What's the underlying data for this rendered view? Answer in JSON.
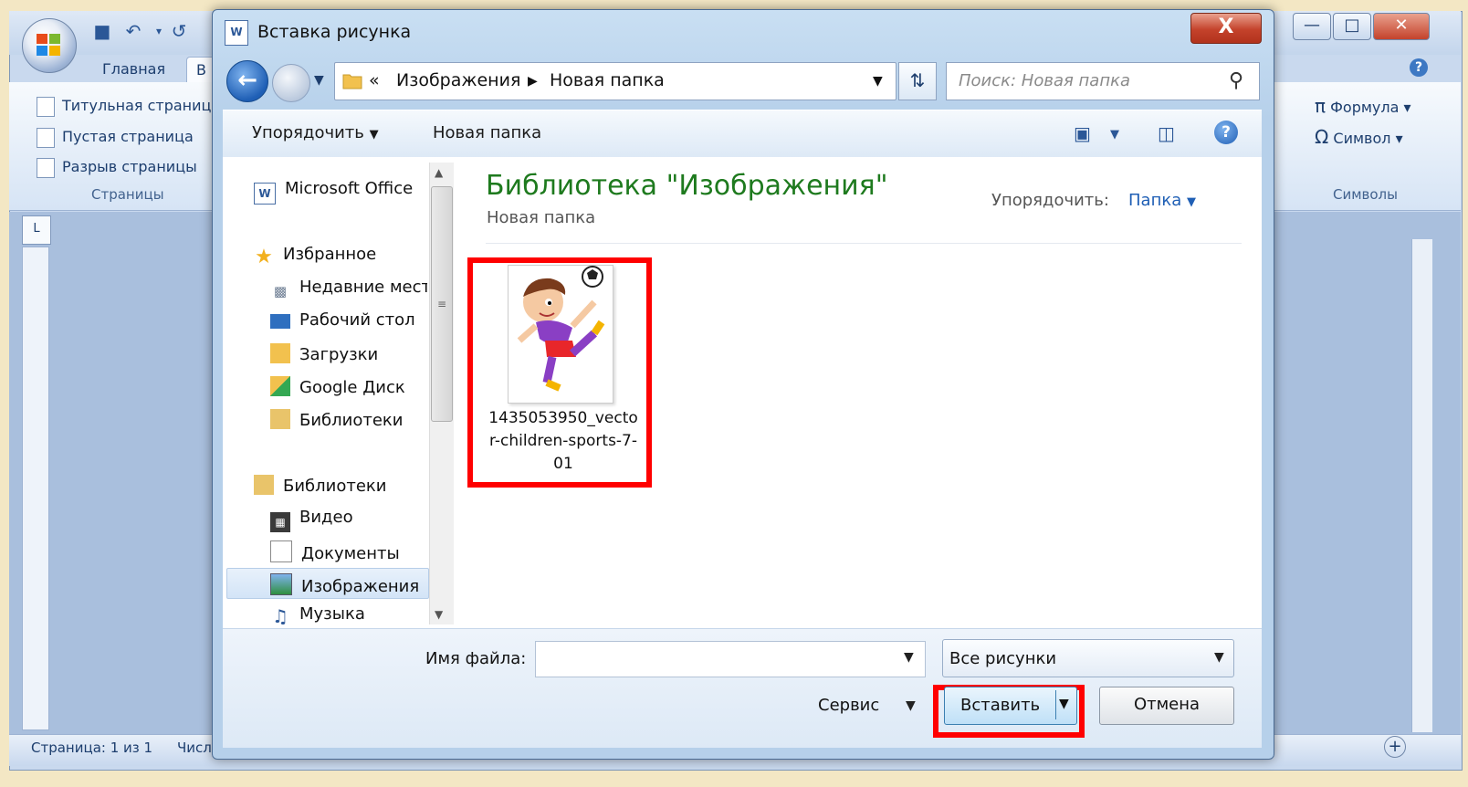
{
  "word": {
    "tabs": [
      "Главная",
      "В"
    ],
    "pages_group": {
      "items": [
        "Титульная страница",
        "Пустая страница",
        "Разрыв страницы"
      ],
      "label": "Страницы"
    },
    "symbols_group": {
      "items": [
        "Формула",
        "Символ"
      ],
      "label": "Символы"
    },
    "status": {
      "page": "Страница: 1 из 1",
      "words": "Числ"
    }
  },
  "dialog": {
    "title": "Вставка рисунка",
    "close_label": "X",
    "address": {
      "prefix": "«",
      "parts": [
        "Изображения",
        "Новая папка"
      ]
    },
    "search_placeholder": "Поиск: Новая папка",
    "toolbar": {
      "organize": "Упорядочить",
      "new_folder": "Новая папка"
    },
    "nav": {
      "top": "Microsoft Office",
      "favorites": "Избранное",
      "favorites_items": [
        "Недавние места",
        "Рабочий стол",
        "Загрузки",
        "Google Диск",
        "Библиотеки"
      ],
      "libraries": "Библиотеки",
      "library_items": [
        "Видео",
        "Документы",
        "Изображения",
        "Музыка"
      ]
    },
    "content": {
      "library_title": "Библиотека \"Изображения\"",
      "subfolder": "Новая папка",
      "sort_label": "Упорядочить:",
      "sort_value": "Папка",
      "files": [
        {
          "name": "1435053950_vector-children-sports-7-01"
        }
      ]
    },
    "filename_label": "Имя файла:",
    "filename_value": "",
    "filter_value": "Все рисунки",
    "service_label": "Сервис",
    "insert_label": "Вставить",
    "cancel_label": "Отмена"
  },
  "colors": {
    "highlight": "#ff0000",
    "library_title": "#1e7a1e",
    "link_blue": "#1f5fb5"
  }
}
